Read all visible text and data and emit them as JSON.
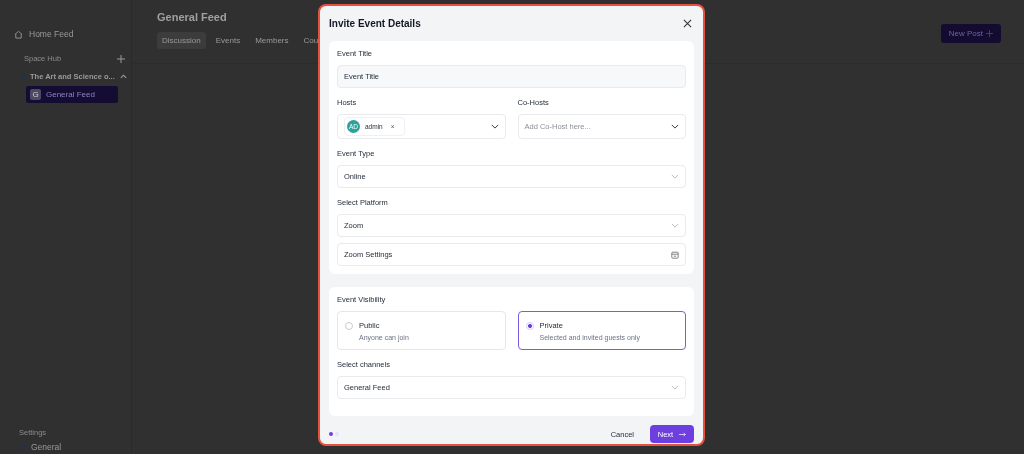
{
  "sidebar": {
    "home": "Home Feed",
    "section": "Space Hub",
    "space": {
      "label": "The Art and Science o...",
      "expanded": true,
      "children": [
        {
          "badge": "G",
          "label": "General Feed",
          "selected": true
        }
      ]
    },
    "settings": "Settings",
    "general": "General"
  },
  "main": {
    "title": "General Feed",
    "tabs": [
      {
        "label": "Discussion",
        "selected": true
      },
      {
        "label": "Events",
        "selected": false
      },
      {
        "label": "Members",
        "selected": false
      },
      {
        "label": "Cou",
        "selected": false
      }
    ],
    "new_post": "New Post"
  },
  "dialog": {
    "title": "Invite Event Details",
    "event_title": {
      "label": "Event Title",
      "placeholder": "Event Title"
    },
    "hosts": {
      "label": "Hosts",
      "chips": [
        {
          "initials": "AD",
          "name": "admin",
          "remove": "×"
        }
      ]
    },
    "co_hosts": {
      "label": "Co-Hosts",
      "placeholder": "Add Co-Host here..."
    },
    "event_type": {
      "label": "Event Type",
      "value": "Online"
    },
    "platform": {
      "label": "Select Platform",
      "value": "Zoom",
      "settings": "Zoom Settings"
    },
    "visibility": {
      "label": "Event Visibility",
      "options": [
        {
          "title": "Public",
          "description": "Anyone can join",
          "selected": false
        },
        {
          "title": "Private",
          "description": "Selected and invited guests only",
          "selected": true
        }
      ]
    },
    "channels": {
      "label": "Select channels",
      "value": "General Feed"
    },
    "steps": [
      {
        "selected": true
      },
      {
        "selected": false
      }
    ],
    "cancel": "Cancel",
    "next": "Next"
  }
}
